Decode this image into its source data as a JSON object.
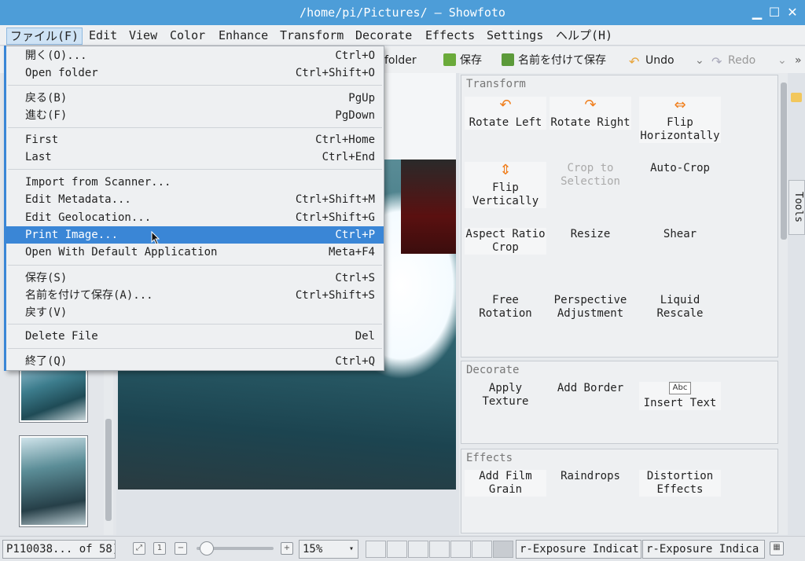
{
  "window": {
    "title": "/home/pi/Pictures/ — Showfoto",
    "controls": [
      "minimize",
      "maximize",
      "close"
    ]
  },
  "menubar": {
    "items": [
      "ファイル(F)",
      "Edit",
      "View",
      "Color",
      "Enhance",
      "Transform",
      "Decorate",
      "Effects",
      "Settings",
      "ヘルプ(H)"
    ]
  },
  "toolbar": {
    "open_folder": "folder",
    "save": "保存",
    "save_as": "名前を付けて保存",
    "undo": "Undo",
    "redo": "Redo"
  },
  "file_menu": {
    "items": [
      {
        "label": "開く(O)...",
        "shortcut": "Ctrl+O"
      },
      {
        "label": "Open folder",
        "shortcut": "Ctrl+Shift+O"
      },
      {
        "label": "戻る(B)",
        "shortcut": "PgUp"
      },
      {
        "label": "進む(F)",
        "shortcut": "PgDown"
      },
      {
        "label": "First",
        "shortcut": "Ctrl+Home"
      },
      {
        "label": "Last",
        "shortcut": "Ctrl+End"
      },
      {
        "label": "Import from Scanner...",
        "shortcut": ""
      },
      {
        "label": "Edit Metadata...",
        "shortcut": "Ctrl+Shift+M"
      },
      {
        "label": "Edit Geolocation...",
        "shortcut": "Ctrl+Shift+G"
      },
      {
        "label": "Print Image...",
        "shortcut": "Ctrl+P"
      },
      {
        "label": "Open With Default Application",
        "shortcut": "Meta+F4"
      },
      {
        "label": "保存(S)",
        "shortcut": "Ctrl+S"
      },
      {
        "label": "名前を付けて保存(A)...",
        "shortcut": "Ctrl+Shift+S"
      },
      {
        "label": "戻す(V)",
        "shortcut": ""
      },
      {
        "label": "Delete File",
        "shortcut": "Del"
      },
      {
        "label": "終了(Q)",
        "shortcut": "Ctrl+Q"
      }
    ],
    "highlighted": "Print Image..."
  },
  "tools_panel": {
    "sections": [
      {
        "title": "Transform",
        "tools": [
          "Rotate Left",
          "Rotate Right",
          "Flip Horizontally",
          "Flip Vertically",
          "Crop to Selection",
          "Auto-Crop",
          "Aspect Ratio Crop",
          "Resize",
          "Shear",
          "Free Rotation",
          "Perspective Adjustment",
          "Liquid Rescale"
        ]
      },
      {
        "title": "Decorate",
        "tools": [
          "Apply Texture",
          "Add Border",
          "Insert Text"
        ]
      },
      {
        "title": "Effects",
        "tools": [
          "Add Film Grain",
          "Raindrops",
          "Distortion Effects"
        ]
      }
    ],
    "side_tab_label": "Tools"
  },
  "statusbar": {
    "file_position": "P110038... of 58)",
    "zoom": "15%",
    "underexposure": "r-Exposure Indicat",
    "overexposure": "r-Exposure Indica"
  }
}
